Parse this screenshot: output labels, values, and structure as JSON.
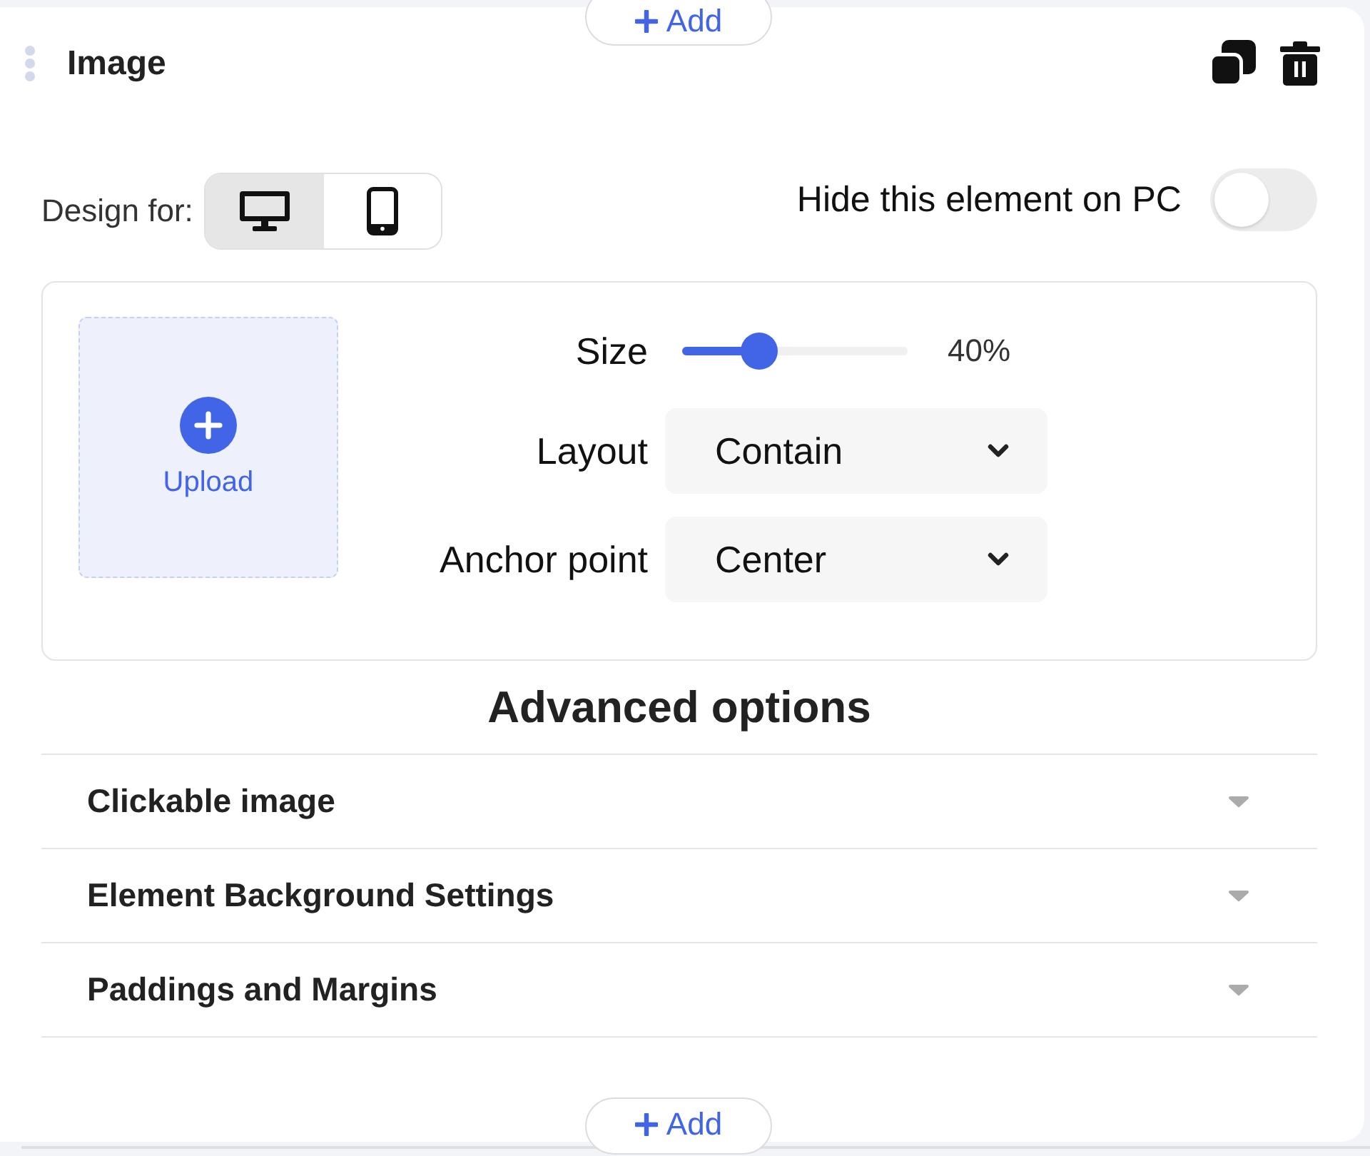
{
  "add_button_top": {
    "label": "Add"
  },
  "header": {
    "title": "Image"
  },
  "design_for": {
    "label": "Design for:",
    "devices": [
      {
        "kind": "desktop",
        "selected": true
      },
      {
        "kind": "mobile",
        "selected": false
      }
    ]
  },
  "hide_toggle": {
    "label": "Hide this element on PC",
    "on": false
  },
  "upload": {
    "label": "Upload"
  },
  "fields": [
    {
      "kind": "slider",
      "label": "Size",
      "level": 0.34,
      "reading": "40%"
    },
    {
      "kind": "select",
      "label": "Layout",
      "value": "Contain"
    },
    {
      "kind": "select",
      "label": "Anchor point",
      "value": "Center"
    }
  ],
  "advanced": {
    "title": "Advanced options",
    "sections": [
      {
        "label": "Clickable image",
        "expanded": false
      },
      {
        "label": "Element Background Settings",
        "expanded": false
      },
      {
        "label": "Paddings and Margins",
        "expanded": false
      }
    ]
  },
  "add_button_bottom": {
    "label": "Add"
  }
}
